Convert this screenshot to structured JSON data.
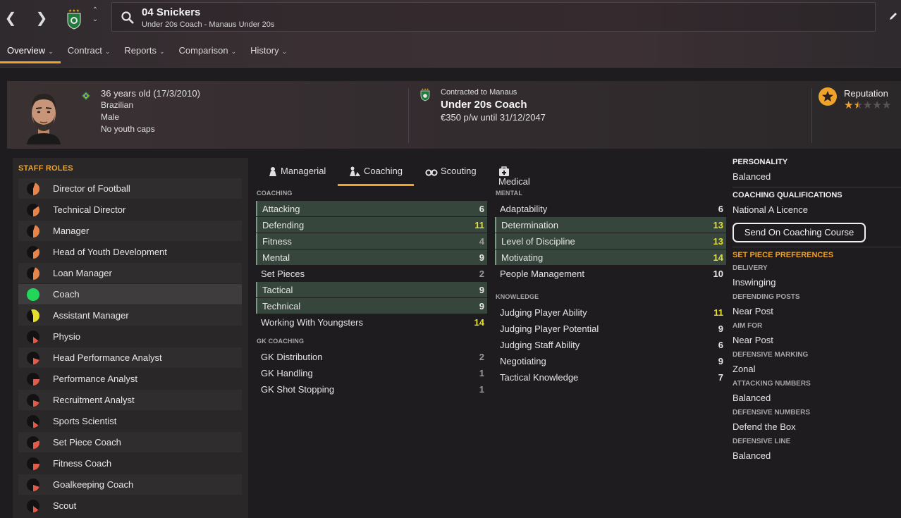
{
  "header": {
    "title": "04 Snickers",
    "subtitle": "Under 20s Coach - Manaus Under 20s",
    "tabs": [
      {
        "label": "Overview",
        "active": true
      },
      {
        "label": "Contract"
      },
      {
        "label": "Reports"
      },
      {
        "label": "Comparison"
      },
      {
        "label": "History"
      }
    ]
  },
  "profile": {
    "age": "36 years old (17/3/2010)",
    "nationality": "Brazilian",
    "gender": "Male",
    "caps": "No youth caps",
    "contract_club": "Contracted to Manaus",
    "contract_role": "Under 20s Coach",
    "contract_wage": "€350 p/w until 31/12/2047",
    "reputation_label": "Reputation",
    "reputation_stars": 1.5
  },
  "staff_roles": {
    "title": "STAFF ROLES",
    "items": [
      {
        "label": "Director of Football",
        "fill": 0.45,
        "color": "#e8844a"
      },
      {
        "label": "Technical Director",
        "fill": 0.35,
        "color": "#e8844a"
      },
      {
        "label": "Manager",
        "fill": 0.45,
        "color": "#e8844a"
      },
      {
        "label": "Head of Youth Development",
        "fill": 0.35,
        "color": "#e8844a"
      },
      {
        "label": "Loan Manager",
        "fill": 0.45,
        "color": "#e8844a"
      },
      {
        "label": "Coach",
        "fill": 1.0,
        "color": "#22d65a"
      },
      {
        "label": "Assistant Manager",
        "fill": 0.55,
        "color": "#e6e02a"
      },
      {
        "label": "Physio",
        "fill": 0.15,
        "color": "#e25a4a"
      },
      {
        "label": "Head Performance Analyst",
        "fill": 0.2,
        "color": "#e25a4a"
      },
      {
        "label": "Performance Analyst",
        "fill": 0.25,
        "color": "#e25a4a"
      },
      {
        "label": "Recruitment Analyst",
        "fill": 0.2,
        "color": "#e25a4a"
      },
      {
        "label": "Sports Scientist",
        "fill": 0.15,
        "color": "#e25a4a"
      },
      {
        "label": "Set Piece Coach",
        "fill": 0.3,
        "color": "#e25a4a"
      },
      {
        "label": "Fitness Coach",
        "fill": 0.25,
        "color": "#e25a4a"
      },
      {
        "label": "Goalkeeping Coach",
        "fill": 0.2,
        "color": "#e25a4a"
      },
      {
        "label": "Scout",
        "fill": 0.15,
        "color": "#e25a4a"
      }
    ]
  },
  "subtabs": [
    {
      "label": "Managerial",
      "icon": "managerial-icon"
    },
    {
      "label": "Coaching",
      "icon": "coaching-icon",
      "active": true
    },
    {
      "label": "Scouting",
      "icon": "binoculars-icon"
    },
    {
      "label": "Medical",
      "icon": "medical-kit-icon"
    }
  ],
  "attributes": {
    "coaching_title": "COACHING",
    "coaching": [
      {
        "name": "Attacking",
        "value": "6",
        "hl": true
      },
      {
        "name": "Defending",
        "value": "11",
        "hl": true,
        "color": "y"
      },
      {
        "name": "Fitness",
        "value": "4",
        "hl": true,
        "color": "g"
      },
      {
        "name": "Mental",
        "value": "9",
        "hl": true
      },
      {
        "name": "Set Pieces",
        "value": "2",
        "color": "g"
      },
      {
        "name": "Tactical",
        "value": "9",
        "hl": true
      },
      {
        "name": "Technical",
        "value": "9",
        "hl": true
      },
      {
        "name": "Working With Youngsters",
        "value": "14",
        "color": "y"
      }
    ],
    "gk_title": "GK COACHING",
    "gk": [
      {
        "name": "GK Distribution",
        "value": "2",
        "color": "g"
      },
      {
        "name": "GK Handling",
        "value": "1",
        "color": "g"
      },
      {
        "name": "GK Shot Stopping",
        "value": "1",
        "color": "g"
      }
    ],
    "mental_title": "MENTAL",
    "mental": [
      {
        "name": "Adaptability",
        "value": "6"
      },
      {
        "name": "Determination",
        "value": "13",
        "hl": true,
        "color": "y"
      },
      {
        "name": "Level of Discipline",
        "value": "13",
        "hl": true,
        "color": "y"
      },
      {
        "name": "Motivating",
        "value": "14",
        "hl": true,
        "color": "y"
      },
      {
        "name": "People Management",
        "value": "10"
      }
    ],
    "knowledge_title": "KNOWLEDGE",
    "knowledge": [
      {
        "name": "Judging Player Ability",
        "value": "11",
        "color": "y"
      },
      {
        "name": "Judging Player Potential",
        "value": "9"
      },
      {
        "name": "Judging Staff Ability",
        "value": "6"
      },
      {
        "name": "Negotiating",
        "value": "9"
      },
      {
        "name": "Tactical Knowledge",
        "value": "7"
      }
    ]
  },
  "right": {
    "personality_title": "PERSONALITY",
    "personality": "Balanced",
    "qual_title": "COACHING QUALIFICATIONS",
    "qual": "National A Licence",
    "course_button": "Send On Coaching Course",
    "setpiece_title": "SET PIECE PREFERENCES",
    "prefs": [
      {
        "label": "DELIVERY",
        "value": "Inswinging"
      },
      {
        "label": "DEFENDING POSTS",
        "value": "Near Post"
      },
      {
        "label": "AIM FOR",
        "value": "Near Post"
      },
      {
        "label": "DEFENSIVE MARKING",
        "value": "Zonal"
      },
      {
        "label": "ATTACKING NUMBERS",
        "value": "Balanced"
      },
      {
        "label": "DEFENSIVE NUMBERS",
        "value": "Defend the Box"
      },
      {
        "label": "DEFENSIVE LINE",
        "value": "Balanced"
      }
    ]
  }
}
